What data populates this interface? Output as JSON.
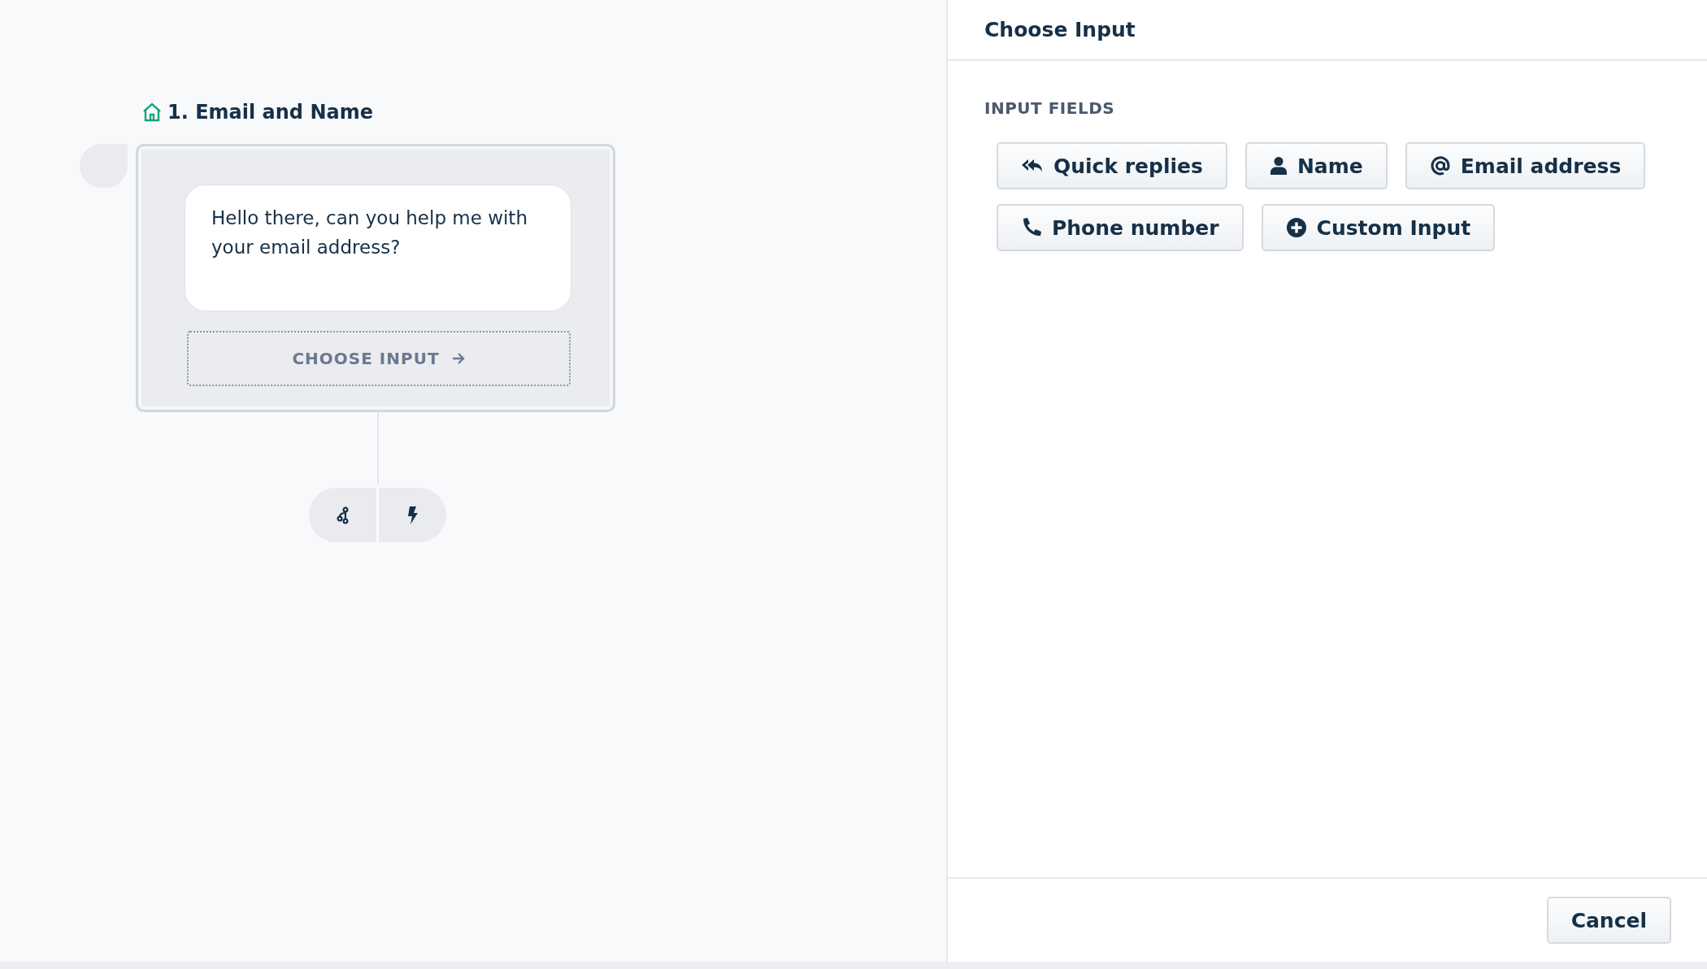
{
  "canvas": {
    "node": {
      "title": "1. Email and Name",
      "message": "Hello there, can you help me with your email address?",
      "choose_input": "CHOOSE INPUT"
    }
  },
  "panel": {
    "title": "Choose Input",
    "section_label": "INPUT FIELDS",
    "input_options": [
      {
        "kind": "quick_replies",
        "label": "Quick replies"
      },
      {
        "kind": "person",
        "label": "Name"
      },
      {
        "kind": "email",
        "label": "Email address"
      },
      {
        "kind": "phone",
        "label": "Phone number"
      },
      {
        "kind": "custom",
        "label": "Custom Input"
      }
    ],
    "footer_buttons": [
      "Cancel"
    ]
  }
}
